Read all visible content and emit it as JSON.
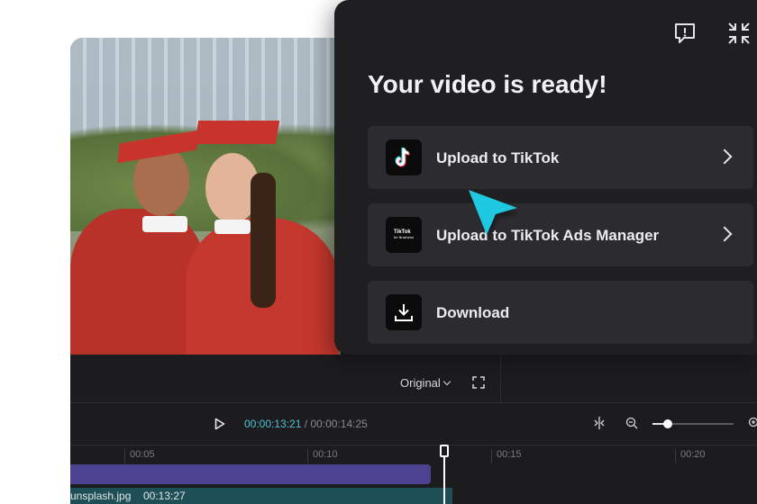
{
  "panel": {
    "title": "Your video is ready!",
    "feedback_icon": "feedback-icon",
    "collapse_icon": "collapse-icon",
    "options": [
      {
        "label": "Upload to TikTok",
        "icon": "tiktok-logo-icon",
        "has_arrow": true
      },
      {
        "label": "Upload to TikTok Ads Manager",
        "icon": "tiktok-for-business-icon",
        "icon_text_1": "TikTok",
        "icon_text_2": "for Business",
        "has_arrow": true
      },
      {
        "label": "Download",
        "icon": "download-icon",
        "has_arrow": false
      }
    ]
  },
  "preview": {
    "ratio_label": "Original",
    "fullscreen_icon": "fullscreen-icon"
  },
  "player": {
    "current_time": "00:00:13:21",
    "separator": "/",
    "total_time": "00:00:14:25"
  },
  "ruler": {
    "ticks": [
      "00:05",
      "00:10",
      "00:15",
      "00:20"
    ]
  },
  "timeline": {
    "clip_name": "unsplash.jpg",
    "clip_duration": "00:13:27"
  },
  "colors": {
    "accent": "#4fc3d4",
    "panel_bg": "#1f1f22",
    "option_bg": "#2c2c30",
    "track_purple": "#4b438f",
    "track_teal": "#1e4f56",
    "cursor": "#1ec8e0"
  }
}
